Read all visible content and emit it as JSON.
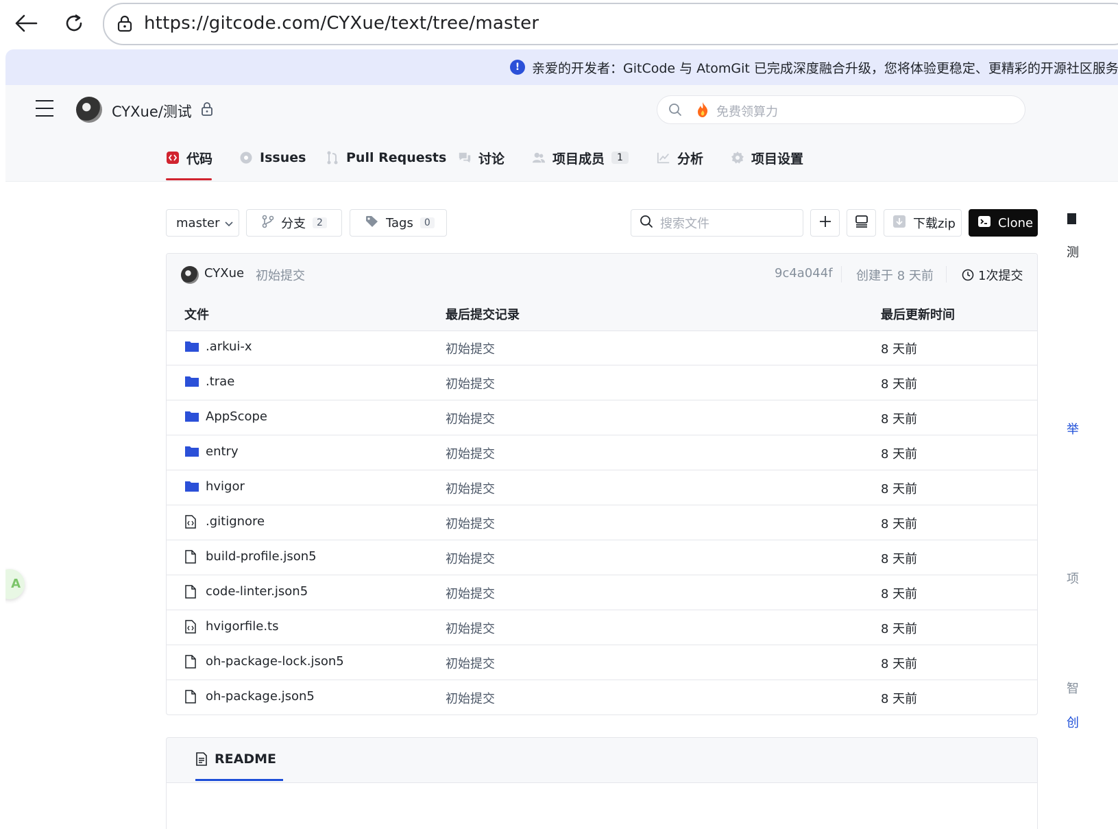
{
  "browser": {
    "url": "https://gitcode.com/CYXue/text/tree/master"
  },
  "notice": {
    "text": "亲爱的开发者：GitCode 与 AtomGit 已完成深度融合升级，您将体验更稳定、更精彩的开源社区服务"
  },
  "header": {
    "repo_name": "CYXue/测试",
    "search_placeholder": "免费领算力"
  },
  "tabs": [
    {
      "label": "代码",
      "icon": "code-icon"
    },
    {
      "label": "Issues",
      "icon": "issue-icon"
    },
    {
      "label": "Pull Requests",
      "icon": "pull-request-icon"
    },
    {
      "label": "讨论",
      "icon": "discussion-icon"
    },
    {
      "label": "项目成员",
      "icon": "members-icon",
      "count": "1"
    },
    {
      "label": "分析",
      "icon": "chart-icon"
    },
    {
      "label": "项目设置",
      "icon": "settings-icon"
    }
  ],
  "toolbar": {
    "branch": "master",
    "branches_label": "分支",
    "branches_count": "2",
    "tags_label": "Tags",
    "tags_count": "0",
    "file_search_placeholder": "搜索文件",
    "download_label": "下载zip",
    "clone_label": "Clone"
  },
  "last_commit": {
    "user": "CYXue",
    "message": "初始提交",
    "hash": "9c4a044f",
    "created": "创建于 8 天前",
    "count": "1次提交"
  },
  "table": {
    "headers": [
      "文件",
      "最后提交记录",
      "最后更新时间"
    ],
    "rows": [
      {
        "name": ".arkui-x",
        "type": "folder",
        "message": "初始提交",
        "time": "8 天前"
      },
      {
        "name": ".trae",
        "type": "folder",
        "message": "初始提交",
        "time": "8 天前"
      },
      {
        "name": "AppScope",
        "type": "folder",
        "message": "初始提交",
        "time": "8 天前"
      },
      {
        "name": "entry",
        "type": "folder",
        "message": "初始提交",
        "time": "8 天前"
      },
      {
        "name": "hvigor",
        "type": "folder",
        "message": "初始提交",
        "time": "8 天前"
      },
      {
        "name": ".gitignore",
        "type": "code-file",
        "message": "初始提交",
        "time": "8 天前"
      },
      {
        "name": "build-profile.json5",
        "type": "file",
        "message": "初始提交",
        "time": "8 天前"
      },
      {
        "name": "code-linter.json5",
        "type": "file",
        "message": "初始提交",
        "time": "8 天前"
      },
      {
        "name": "hvigorfile.ts",
        "type": "code-file",
        "message": "初始提交",
        "time": "8 天前"
      },
      {
        "name": "oh-package-lock.json5",
        "type": "file",
        "message": "初始提交",
        "time": "8 天前"
      },
      {
        "name": "oh-package.json5",
        "type": "file",
        "message": "初始提交",
        "time": "8 天前"
      }
    ]
  },
  "readme": {
    "label": "README"
  },
  "side_cutoff": [
    "测",
    "举",
    "项",
    "智",
    "创"
  ],
  "colors": {
    "accent_red": "#d1242f",
    "folder_blue": "#2b50d8",
    "notice_bg": "#e6eafc",
    "clone_bg": "#0d0d0d"
  }
}
